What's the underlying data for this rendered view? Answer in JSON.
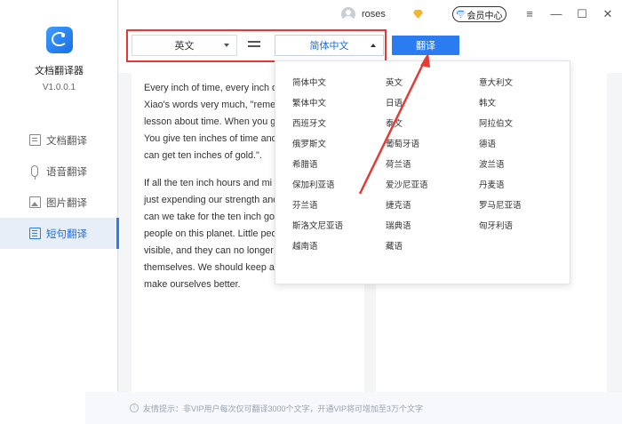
{
  "app": {
    "name": "文档翻译器",
    "version": "V1.0.0.1"
  },
  "sidebar": {
    "items": [
      {
        "label": "文档翻译",
        "icon": "document-icon"
      },
      {
        "label": "语音翻译",
        "icon": "microphone-icon"
      },
      {
        "label": "图片翻译",
        "icon": "image-icon"
      },
      {
        "label": "短句翻译",
        "icon": "sentence-icon",
        "active": true
      }
    ]
  },
  "titlebar": {
    "username": "roses",
    "vip_label": "会员中心",
    "menu_icon": "≡",
    "minimize_icon": "—",
    "maximize_icon": "☐",
    "close_icon": "✕"
  },
  "toolbar": {
    "source_lang": "英文",
    "target_lang": "简体中文",
    "translate_label": "翻译"
  },
  "source_text": {
    "p1": "Every inch of time, every inch of Xiao's words very much, \"remem lesson about time. When you g You give ten inches of time and can get ten inches of gold.\".",
    "p2": "If all the ten inch hours and mi just expending our strength and can we take for the ten inch go people on this planet. Little peo visible, and they can no longer themselves. We should keep all make ourselves better."
  },
  "source_lines": {
    "p1": [
      "Every inch of time, every inch of",
      "Xiao's words very much, \"remem",
      "lesson about time. When you g",
      "You give ten inches of time and",
      "can get ten inches of gold.\"."
    ],
    "p2": [
      "If all the ten inch hours and mi",
      "just expending our strength and",
      "can we take for the ten inch go",
      "people on this planet. Little peo",
      "visible, and they can no longer",
      "themselves. We should keep all",
      "make ourselves better."
    ]
  },
  "dropdown": {
    "languages": [
      "简体中文",
      "英文",
      "意大利文",
      "繁体中文",
      "日语",
      "韩文",
      "西班牙文",
      "泰文",
      "阿拉伯文",
      "俄罗斯文",
      "葡萄牙语",
      "德语",
      "希腊语",
      "荷兰语",
      "波兰语",
      "保加利亚语",
      "爱沙尼亚语",
      "丹麦语",
      "芬兰语",
      "捷克语",
      "罗马尼亚语",
      "斯洛文尼亚语",
      "瑞典语",
      "匈牙利语",
      "越南语",
      "藏语"
    ]
  },
  "notice": {
    "text": "友情提示：非VIP用户每次仅可翻译3000个文字，开通VIP将可增加至3万个文字"
  },
  "colors": {
    "accent": "#2a7cf0",
    "highlight_frame": "#e53935",
    "arrow": "#e53935"
  }
}
